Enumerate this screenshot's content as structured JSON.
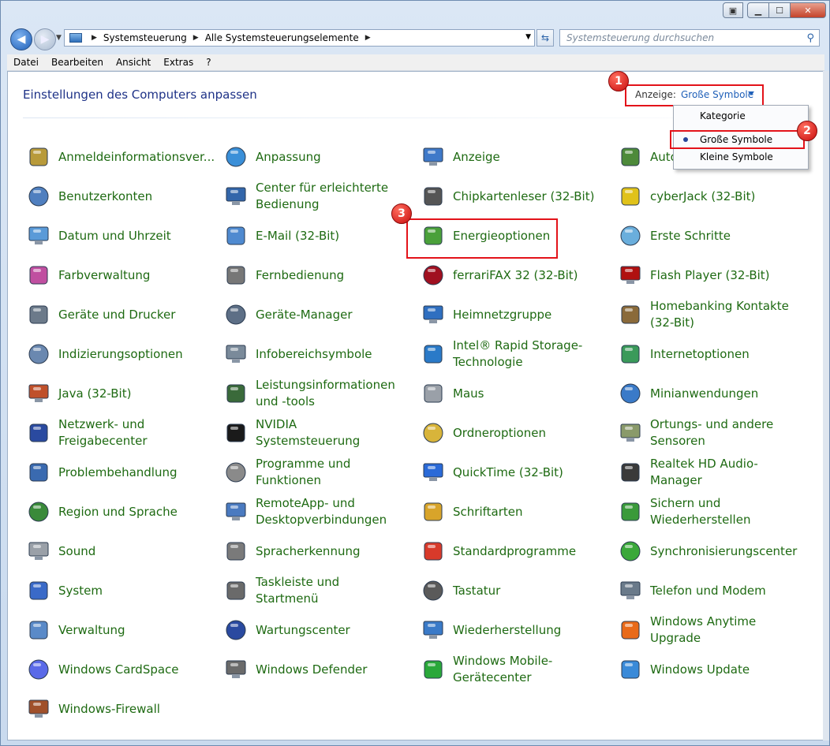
{
  "window": {
    "controls": {
      "min": "▁",
      "max": "☐",
      "close": "✕"
    }
  },
  "address": {
    "crumbs": [
      "Systemsteuerung",
      "Alle Systemsteuerungselemente"
    ],
    "search_placeholder": "Systemsteuerung durchsuchen"
  },
  "menu": [
    "Datei",
    "Bearbeiten",
    "Ansicht",
    "Extras",
    "?"
  ],
  "page_title": "Einstellungen des Computers anpassen",
  "view": {
    "label": "Anzeige:",
    "value": "Große Symbole",
    "options": [
      "Kategorie",
      "Große Symbole",
      "Kleine Symbole"
    ],
    "selected": "Große Symbole"
  },
  "markers": [
    "1",
    "2",
    "3"
  ],
  "items": [
    [
      "Anmeldeinformationsver...",
      "Anpassung",
      "Anzeige",
      "Autom..."
    ],
    [
      "Benutzerkonten",
      "Center für erleichterte Bedienung",
      "Chipkartenleser (32-Bit)",
      "cyberJack  (32-Bit)"
    ],
    [
      "Datum und Uhrzeit",
      "E-Mail (32-Bit)",
      "Energieoptionen",
      "Erste Schritte"
    ],
    [
      "Farbverwaltung",
      "Fernbedienung",
      "ferrariFAX 32 (32-Bit)",
      "Flash Player (32-Bit)"
    ],
    [
      "Geräte und Drucker",
      "Geräte-Manager",
      "Heimnetzgruppe",
      "Homebanking Kontakte (32-Bit)"
    ],
    [
      "Indizierungsoptionen",
      "Infobereichsymbole",
      "Intel® Rapid Storage-Technologie",
      "Internetoptionen"
    ],
    [
      "Java (32-Bit)",
      "Leistungsinformationen und -tools",
      "Maus",
      "Minianwendungen"
    ],
    [
      "Netzwerk- und Freigabecenter",
      "NVIDIA Systemsteuerung",
      "Ordneroptionen",
      "Ortungs- und andere Sensoren"
    ],
    [
      "Problembehandlung",
      "Programme und Funktionen",
      "QuickTime (32-Bit)",
      "Realtek HD Audio-Manager"
    ],
    [
      "Region und Sprache",
      "RemoteApp- und Desktopverbindungen",
      "Schriftarten",
      "Sichern und Wiederherstellen"
    ],
    [
      "Sound",
      "Spracherkennung",
      "Standardprogramme",
      "Synchronisierungscenter"
    ],
    [
      "System",
      "Taskleiste und Startmenü",
      "Tastatur",
      "Telefon und Modem"
    ],
    [
      "Verwaltung",
      "Wartungscenter",
      "Wiederherstellung",
      "Windows Anytime Upgrade"
    ],
    [
      "Windows CardSpace",
      "Windows Defender",
      "Windows Mobile-Gerätecenter",
      "Windows Update"
    ],
    [
      "Windows-Firewall"
    ]
  ],
  "icon_colors": [
    [
      "#b89a3a",
      "#3a8fd8",
      "#3f79c9",
      "#4d8a3a"
    ],
    [
      "#4f7fbf",
      "#3366aa",
      "#555555",
      "#e0c21a"
    ],
    [
      "#5a9ad8",
      "#4f8ad0",
      "#4aa03a",
      "#6aaedc"
    ],
    [
      "#c04fa0",
      "#777777",
      "#a01020",
      "#b01010"
    ],
    [
      "#6c7a8a",
      "#5d6f86",
      "#2f6fc0",
      "#8a6a3a"
    ],
    [
      "#6a88b0",
      "#7a8a9a",
      "#2a7ac8",
      "#3a9a5a"
    ],
    [
      "#c0502a",
      "#3a6a3a",
      "#9aa0a8",
      "#3a7ac8"
    ],
    [
      "#2a4aa0",
      "#1a1a1a",
      "#d8b43a",
      "#8a9a6a"
    ],
    [
      "#3a6ab0",
      "#8a8a8a",
      "#2a6ad8",
      "#3a3a3a"
    ],
    [
      "#3a8a3a",
      "#4a7ac0",
      "#d8a42a",
      "#3a9a3a"
    ],
    [
      "#9aa0a8",
      "#7a7a7a",
      "#d83a2a",
      "#3aa83a"
    ],
    [
      "#3a6ac8",
      "#6a6a6a",
      "#5a5a5a",
      "#6a7a8a"
    ],
    [
      "#5a8ac8",
      "#2a4aa0",
      "#3a7ac8",
      "#e86a1a"
    ],
    [
      "#5a6ae8",
      "#6a6a6a",
      "#2aa83a",
      "#3a8ad8"
    ],
    [
      "#a0502a"
    ]
  ]
}
